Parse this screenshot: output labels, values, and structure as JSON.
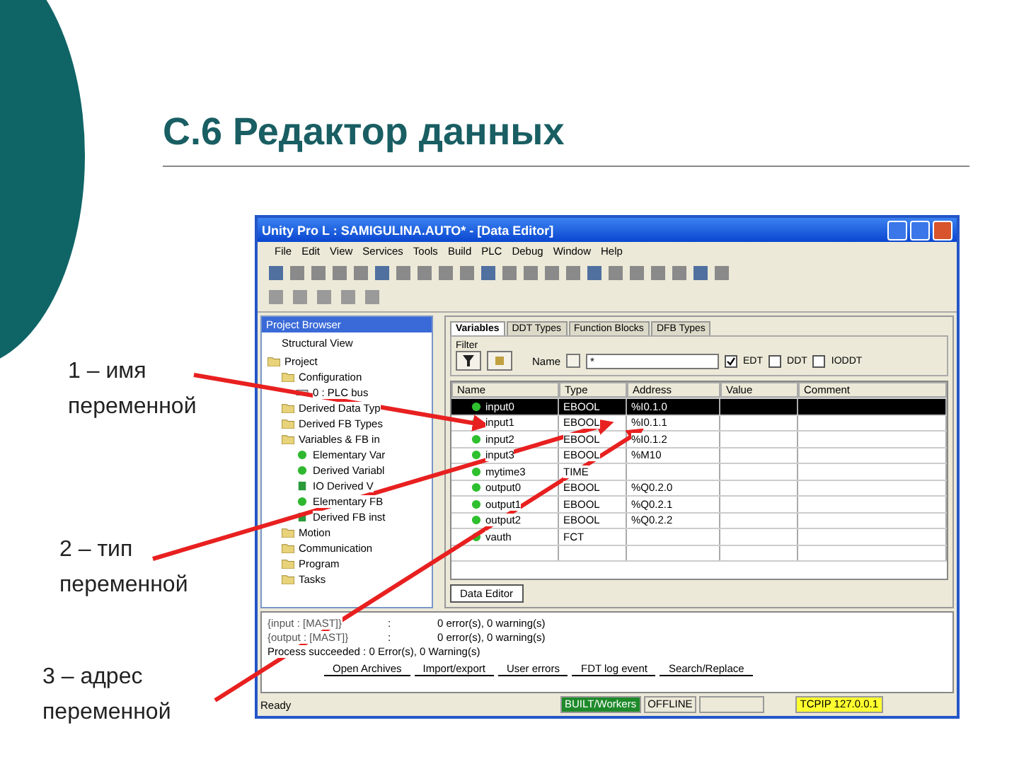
{
  "slide": {
    "title": "С.6 Редактор данных",
    "callouts": [
      {
        "number": "1",
        "text": "– имя",
        "sub": "переменной"
      },
      {
        "number": "2",
        "text": "– тип",
        "sub": "переменной"
      },
      {
        "number": "3",
        "text": "– адрес",
        "sub": "переменной"
      }
    ]
  },
  "window": {
    "title": "Unity Pro L : SAMIGULINA.AUTO* - [Data Editor]"
  },
  "menu": [
    "File",
    "Edit",
    "View",
    "Services",
    "Tools",
    "Build",
    "PLC",
    "Debug",
    "Window",
    "Help"
  ],
  "project_browser": {
    "title": "Project Browser",
    "view": "Structural View",
    "tree": [
      {
        "label": "Project",
        "kind": "folder",
        "children": [
          {
            "label": "Configuration",
            "kind": "folder",
            "children": [
              {
                "label": "0 : PLC bus",
                "kind": "bus"
              }
            ]
          },
          {
            "label": "Derived Data Typ",
            "kind": "folder"
          },
          {
            "label": "Derived FB Types",
            "kind": "folder"
          },
          {
            "label": "Variables & FB in",
            "kind": "folder",
            "children": [
              {
                "label": "Elementary Var",
                "kind": "variable"
              },
              {
                "label": "Derived Variabl",
                "kind": "variable"
              },
              {
                "label": "IO Derived V",
                "kind": "block"
              },
              {
                "label": "Elementary FB",
                "kind": "variable"
              },
              {
                "label": "Derived FB inst",
                "kind": "block"
              }
            ]
          },
          {
            "label": "Motion",
            "kind": "folder"
          },
          {
            "label": "Communication",
            "kind": "folder"
          },
          {
            "label": "Program",
            "kind": "folder"
          },
          {
            "label": "Tasks",
            "kind": "folder"
          }
        ]
      }
    ]
  },
  "editor": {
    "tabs": [
      {
        "label": "Variables",
        "selected": true
      },
      {
        "label": "DDT Types",
        "selected": false
      },
      {
        "label": "Function Blocks",
        "selected": false
      },
      {
        "label": "DFB Types",
        "selected": false
      }
    ],
    "filter_label": "Filter",
    "name_label": "Name",
    "name_value": "*",
    "filters": [
      {
        "label": "EDT",
        "checked": true
      },
      {
        "label": "DDT",
        "checked": false
      },
      {
        "label": "IODDT",
        "checked": false
      }
    ],
    "columns": [
      "Name",
      "Type",
      "Address",
      "Value",
      "Comment"
    ],
    "rows": [
      {
        "name": "input0",
        "type": "EBOOL",
        "address": "%I0.1.0",
        "selected": true
      },
      {
        "name": "input1",
        "type": "EBOOL",
        "address": "%I0.1.1",
        "selected": false
      },
      {
        "name": "input2",
        "type": "EBOOL",
        "address": "%I0.1.2",
        "selected": false
      },
      {
        "name": "input3",
        "type": "EBOOL",
        "address": "%M10",
        "selected": false
      },
      {
        "name": "mytime3",
        "type": "TIME",
        "address": "",
        "selected": false
      },
      {
        "name": "output0",
        "type": "EBOOL",
        "address": "%Q0.2.0",
        "selected": false
      },
      {
        "name": "output1",
        "type": "EBOOL",
        "address": "%Q0.2.1",
        "selected": false
      },
      {
        "name": "output2",
        "type": "EBOOL",
        "address": "%Q0.2.2",
        "selected": false
      },
      {
        "name": "vauth",
        "type": "FCT",
        "address": "",
        "selected": false
      }
    ],
    "doc_tab": "Data Editor"
  },
  "output": {
    "lines": [
      {
        "source": "{input : [MAST]}",
        "sep": ":",
        "message": "0 error(s), 0 warning(s)"
      },
      {
        "source": "{output : [MAST]}",
        "sep": ":",
        "message": "0 error(s), 0 warning(s)"
      }
    ],
    "summary": "Process succeeded : 0 Error(s), 0 Warning(s)",
    "tabs": [
      "Open Archives",
      "Import/export",
      "User errors",
      "FDT log event",
      "Search/Replace"
    ]
  },
  "status_bar": {
    "text": "Ready",
    "build": "BUILT/Workers",
    "mode": "OFFLINE",
    "link": "TCPIP 127.0.0.1"
  }
}
